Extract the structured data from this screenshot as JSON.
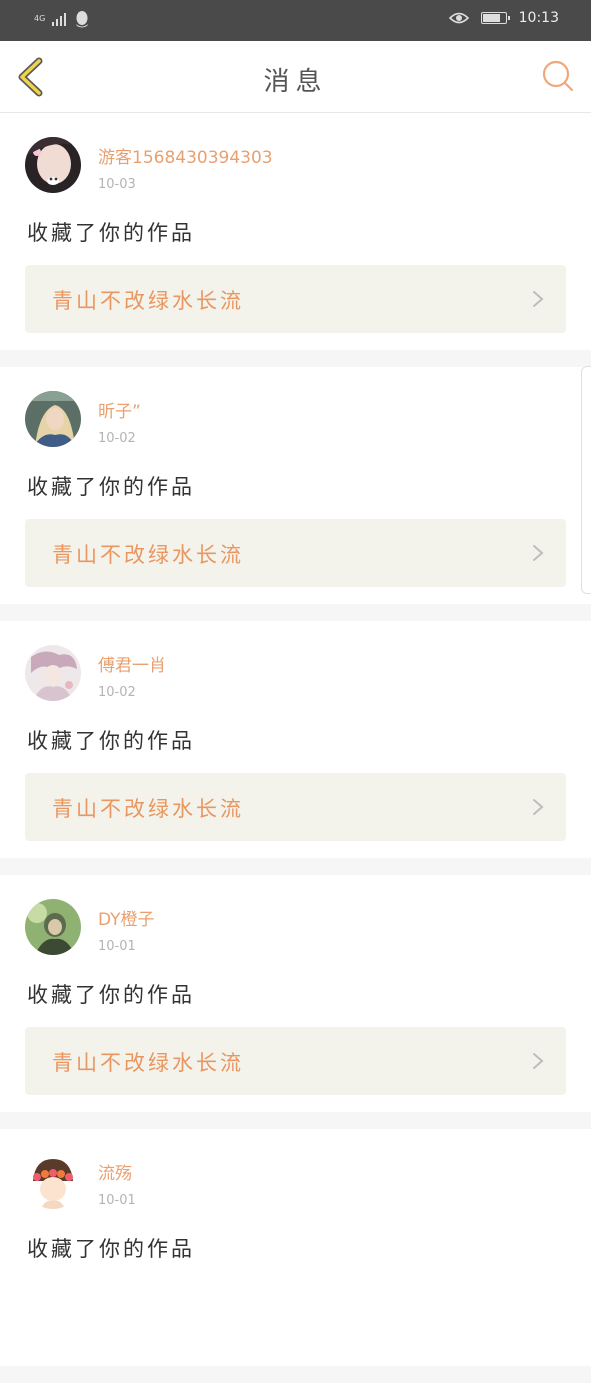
{
  "status_bar": {
    "network": "4G",
    "time": "10:13",
    "battery_level": 0.8
  },
  "header": {
    "title": "消息",
    "back_icon": "chevron-left-icon",
    "search_icon": "search-icon"
  },
  "colors": {
    "accent": "#e99660",
    "username": "#e9a06f",
    "back": "#e2c640",
    "card_bg": "#f3f3ec"
  },
  "messages": [
    {
      "username": "游客1568430394303",
      "date": "10-03",
      "action": "收藏了你的作品",
      "work_title": "青山不改绿水长流",
      "avatar_icon": "user-avatar"
    },
    {
      "username": "昕子”",
      "date": "10-02",
      "action": "收藏了你的作品",
      "work_title": "青山不改绿水长流",
      "avatar_icon": "user-avatar"
    },
    {
      "username": "傅君一肖",
      "date": "10-02",
      "action": "收藏了你的作品",
      "work_title": "青山不改绿水长流",
      "avatar_icon": "user-avatar"
    },
    {
      "username": "DY橙子",
      "date": "10-01",
      "action": "收藏了你的作品",
      "work_title": "青山不改绿水长流",
      "avatar_icon": "user-avatar"
    },
    {
      "username": "流殇",
      "date": "10-01",
      "action": "收藏了你的作品",
      "work_title": "",
      "avatar_icon": "user-avatar"
    }
  ]
}
